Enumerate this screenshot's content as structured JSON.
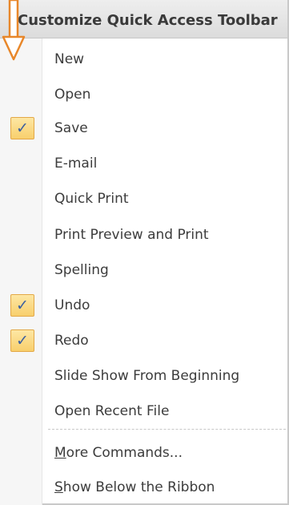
{
  "menu": {
    "title": "Customize Quick Access Toolbar",
    "check_glyph": "✓",
    "items": [
      {
        "label": "New",
        "checked": false
      },
      {
        "label": "Open",
        "checked": false
      },
      {
        "label": "Save",
        "checked": true
      },
      {
        "label": "E-mail",
        "checked": false
      },
      {
        "label": "Quick Print",
        "checked": false
      },
      {
        "label": "Print Preview and Print",
        "checked": false
      },
      {
        "label": "Spelling",
        "checked": false
      },
      {
        "label": "Undo",
        "checked": true
      },
      {
        "label": "Redo",
        "checked": true
      },
      {
        "label": "Slide Show From Beginning",
        "checked": false
      },
      {
        "label": "Open Recent File",
        "checked": false
      }
    ],
    "more_commands": {
      "access_key": "M",
      "rest": "ore Commands..."
    },
    "show_below": {
      "access_key": "S",
      "rest": "how Below the Ribbon"
    }
  },
  "colors": {
    "check_fill": "#f8cf6c",
    "check_border": "#e3a847",
    "arrow": "#e8872a"
  }
}
